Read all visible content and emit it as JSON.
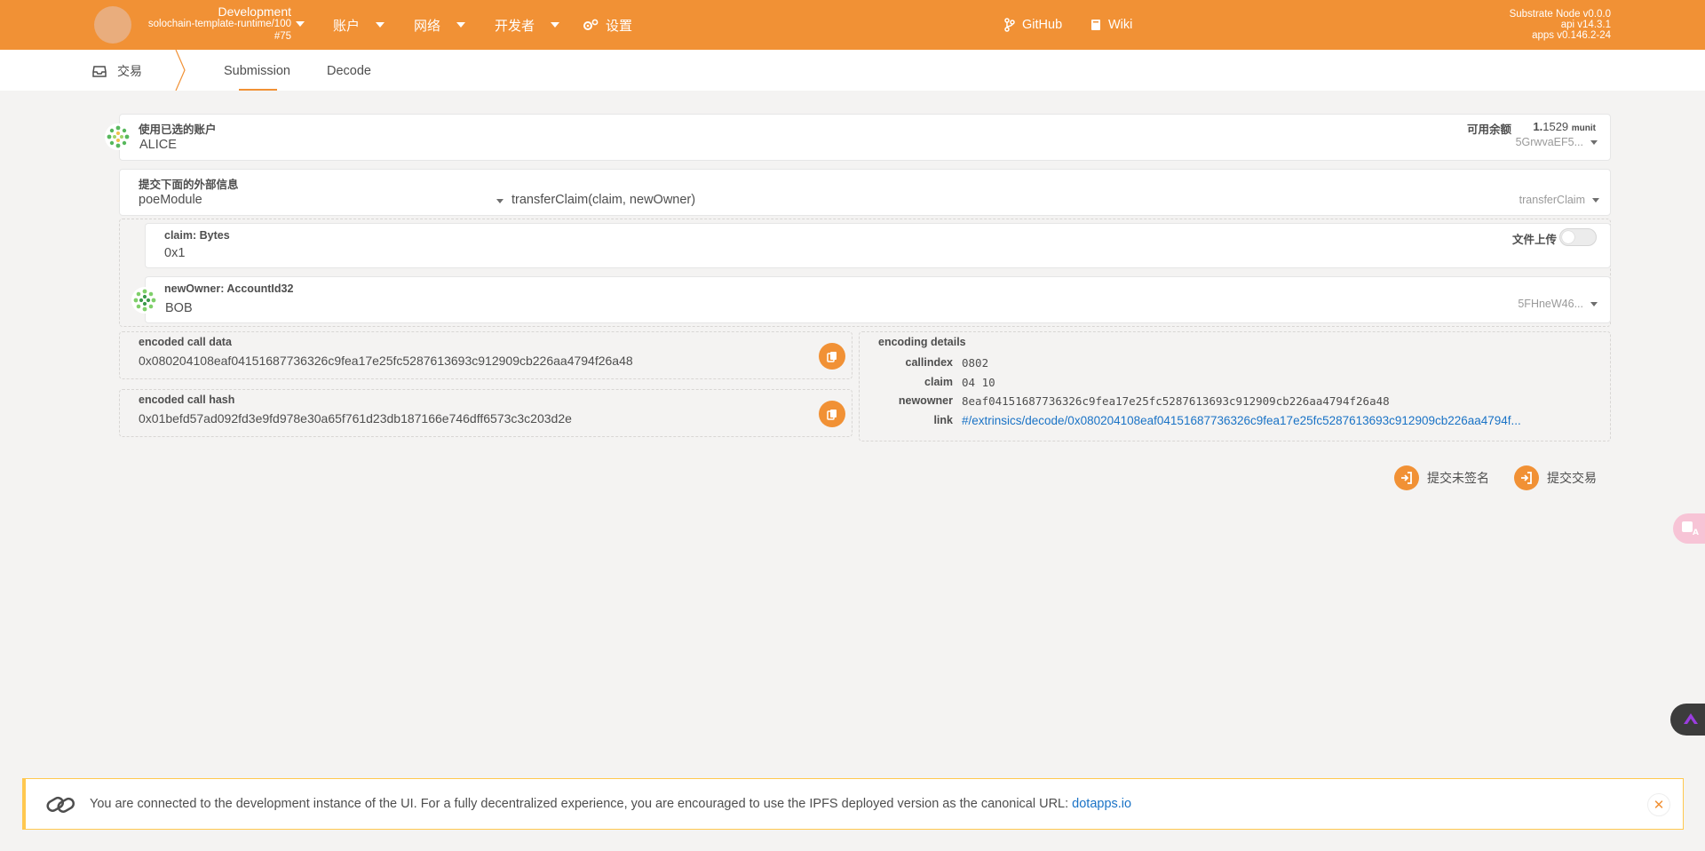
{
  "header": {
    "chain_name": "Development",
    "runtime": "solochain-template-runtime/100",
    "block": "#75",
    "nav": [
      {
        "label": "账户",
        "icon": "none"
      },
      {
        "label": "网络",
        "icon": "none"
      },
      {
        "label": "开发者",
        "icon": "none"
      },
      {
        "label": "设置",
        "icon": "gears-icon"
      }
    ],
    "links": [
      {
        "label": "GitHub",
        "icon": "code-branch-icon"
      },
      {
        "label": "Wiki",
        "icon": "book-icon"
      }
    ],
    "node_info": {
      "node": "Substrate Node v0.0.0",
      "api": "api v14.3.1",
      "apps": "apps v0.146.2-24"
    },
    "colors": {
      "accent": "#f19135"
    }
  },
  "subnav": {
    "section": "交易",
    "tabs": [
      "Submission",
      "Decode"
    ]
  },
  "account": {
    "label": "使用已选的账户",
    "name": "ALICE",
    "balance_label": "可用余额",
    "balance_int": "1.",
    "balance_frac": "1529",
    "balance_unit": "munit",
    "address": "5GrwvaEF5..."
  },
  "extrinsic": {
    "label": "提交下面的外部信息",
    "module": "poeModule",
    "method": "transferClaim(claim, newOwner)",
    "method_short": "transferClaim"
  },
  "params": {
    "claim_label": "claim: Bytes",
    "claim_value": "0x1",
    "file_upload_label": "文件上传",
    "owner_label": "newOwner: AccountId32",
    "owner_value": "BOB",
    "owner_address": "5FHneW46..."
  },
  "encoded": {
    "call_data_label": "encoded call data",
    "call_data": "0x080204108eaf04151687736326c9fea17e25fc5287613693c912909cb226aa4794f26a48",
    "call_hash_label": "encoded call hash",
    "call_hash": "0x01befd57ad092fd3e9fd978e30a65f761d23db187166e746dff6573c3c203d2e"
  },
  "details": {
    "title": "encoding details",
    "rows": [
      {
        "key": "callindex",
        "value": "0802"
      },
      {
        "key": "claim",
        "value": "04 10"
      },
      {
        "key": "newowner",
        "value": "8eaf04151687736326c9fea17e25fc5287613693c912909cb226aa4794f26a48"
      }
    ],
    "link_key": "link",
    "link_value": "#/extrinsics/decode/0x080204108eaf04151687736326c9fea17e25fc5287613693c912909cb226aa4794f..."
  },
  "actions": {
    "submit_unsigned": "提交未签名",
    "submit": "提交交易"
  },
  "banner": {
    "text": "You are connected to the development instance of the UI. For a fully decentralized experience, you are encouraged to use the IPFS deployed version as the canonical URL: ",
    "link": "dotapps.io"
  }
}
